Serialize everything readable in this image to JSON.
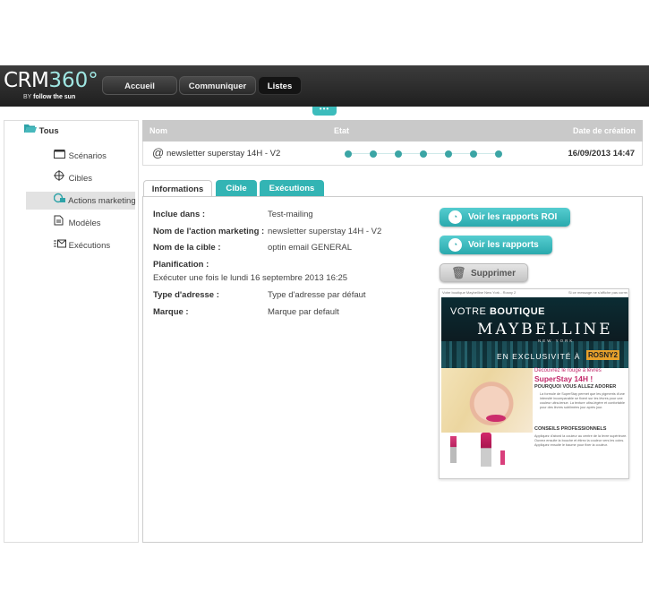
{
  "header": {
    "logo_text": "CRM",
    "logo_number": "360°",
    "tagline_by": "BY",
    "tagline_brand": "follow the sun",
    "nav": [
      {
        "label": "Accueil"
      },
      {
        "label": "Communiquer"
      },
      {
        "label": "Listes"
      }
    ],
    "handle_label": "•••"
  },
  "sidebar": {
    "items": [
      {
        "label": "Tous",
        "icon": "folder-open-icon"
      },
      {
        "label": "Scénarios",
        "icon": "clapperboard-icon"
      },
      {
        "label": "Cibles",
        "icon": "crosshair-icon"
      },
      {
        "label": "Actions marketing",
        "icon": "action-marketing-icon"
      },
      {
        "label": "Modèles",
        "icon": "template-icon"
      },
      {
        "label": "Exécutions",
        "icon": "execution-icon"
      }
    ]
  },
  "list": {
    "columns": [
      "Nom",
      "Etat",
      "Date de création"
    ],
    "row": {
      "name": "newsletter superstay 14H - V2",
      "date": "16/09/2013 14:47",
      "state_steps": 7
    }
  },
  "tabs": [
    {
      "label": "Informations"
    },
    {
      "label": "Cible"
    },
    {
      "label": "Exécutions"
    }
  ],
  "details": {
    "incluse_label": "Inclue dans :",
    "incluse_value": "Test-mailing",
    "action_label": "Nom de l'action marketing :",
    "action_value": "newsletter superstay 14H - V2",
    "cible_label": "Nom de la cible :",
    "cible_value": "optin email GENERAL",
    "planif_label": "Planification :",
    "planif_value": "Exécuter une fois le lundi 16 septembre 2013 16:25",
    "adresse_label": "Type d'adresse :",
    "adresse_value": "Type d'adresse par défaut",
    "marque_label": "Marque :",
    "marque_value": "Marque par default"
  },
  "actions": {
    "roi_label": "Voir les rapports ROI",
    "rapports_label": "Voir les rapports",
    "supprimer_label": "Supprimer"
  },
  "preview": {
    "top_left": "Votre boutique Maybelline New York - Rosny 2",
    "top_right": "Si ce message ne s'affiche pas correctement cliquez ici",
    "line1_a": "VOTRE ",
    "line1_b": "BOUTIQUE",
    "brand": "MAYBELLINE",
    "brand_sub": "NEW YORK",
    "exclu": "EN EXCLUSIVITÉ À",
    "rosny": "ROSNY2",
    "pink_line": "Découvrez le rouge à lèvres",
    "product": "SuperStay 14H !",
    "sub1": "POURQUOI VOUS ALLEZ ADORER",
    "body1": "La formule de SuperStay permet que les pigments d'une intensité incomparable se fixent sur les lèvres pour une couleur ultra-tenue. La texture ultra-légère et confortable pour des lèvres sublimées jour après jour.",
    "sub2": "CONSEILS PROFESSIONNELS",
    "body2": "Appliquez d'abord la couleur au centre de la lèvre supérieure. Ouvrez ensuite la bouche et étirez la couleur vers les coins. Appliquez ensuite le baume pour fixer la couleur."
  },
  "colors": {
    "accent": "#33b4b4",
    "header_bg": "#2b2b2b",
    "state_dot": "#3ba5a5"
  }
}
